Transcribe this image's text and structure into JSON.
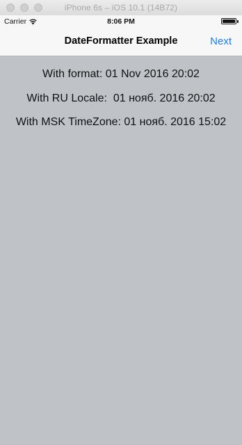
{
  "simulator": {
    "title": "iPhone 6s – iOS 10.1 (14B72)"
  },
  "status_bar": {
    "carrier": "Carrier",
    "time": "8:06 PM",
    "wifi_icon": "wifi-icon",
    "battery_icon": "battery-icon",
    "battery_level": 1.0
  },
  "nav_bar": {
    "title": "DateFormatter Example",
    "next_label": "Next"
  },
  "labels": {
    "format": "With format: 01 Nov 2016 20:02",
    "ru_locale": "With RU Locale:  01 нояб. 2016 20:02",
    "msk_timezone": "With MSK TimeZone: 01 нояб. 2016 15:02"
  },
  "colors": {
    "background": "#bfc3c7",
    "nav_background": "#f7f7f7",
    "accent": "#1b7cf2"
  }
}
